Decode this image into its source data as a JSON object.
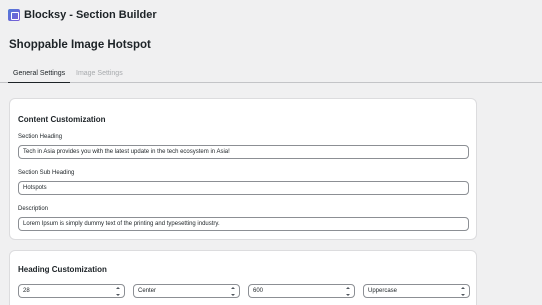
{
  "app": {
    "title": "Blocksy - Section Builder"
  },
  "page": {
    "title": "Shoppable Image Hotspot"
  },
  "tabs": [
    {
      "label": "General Settings"
    },
    {
      "label": "Image Settings"
    }
  ],
  "content_card": {
    "title": "Content Customization",
    "section_heading": {
      "label": "Section Heading",
      "value": "Tech in Asia provides you with the latest update in the tech ecosystem in Asia!"
    },
    "section_sub_heading": {
      "label": "Section Sub Heading",
      "value": "Hotspots"
    },
    "description": {
      "label": "Description",
      "value": "Lorem Ipsum is simply dummy text of the printing and typesetting industry."
    }
  },
  "heading_card": {
    "title": "Heading Customization",
    "font_size": "28",
    "alignment": "Center",
    "font_weight": "600",
    "text_transform": "Uppercase"
  },
  "colors": {
    "background": "#f0f0f1",
    "card": "#ffffff",
    "border": "#8c8f94"
  }
}
